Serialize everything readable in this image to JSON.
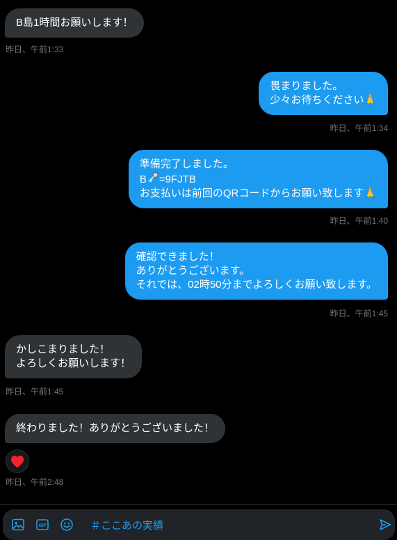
{
  "messages": [
    {
      "lines": [
        "B島1時間お願いします！"
      ],
      "time": "昨日、午前1:33"
    },
    {
      "lines": [
        "畏まりました。",
        "少々お待ちください🙏"
      ],
      "time": "昨日、午前1:34"
    },
    {
      "lines": [
        "準備完了しました。",
        "B",
        "=9FJTB",
        "お支払いは前回のQRコードからお願い致します🙏"
      ],
      "time": "昨日、午前1:40"
    },
    {
      "lines": [
        "確認できました！",
        "ありがとうございます。",
        "それでは、02時50分までよろしくお願い致します。"
      ],
      "time": "昨日、午前1:45"
    },
    {
      "lines": [
        "かしこまりました！",
        "よろしくお願いします！"
      ],
      "time": "昨日、午前1:45"
    },
    {
      "lines": [
        "終わりました！ありがとうございました！"
      ],
      "time": "昨日、午前2:48"
    }
  ],
  "composer": {
    "value": "＃ここあの実績"
  },
  "colors": {
    "background": "#000000",
    "incoming_bubble": "#2f3336",
    "outgoing_bubble": "#1d9bf0",
    "accent": "#1d9bf0",
    "timestamp": "#71767b",
    "heart": "#f91880"
  },
  "icons": [
    "image-icon",
    "gif-icon",
    "emoji-icon",
    "send-icon",
    "key-icon",
    "heart-icon"
  ]
}
